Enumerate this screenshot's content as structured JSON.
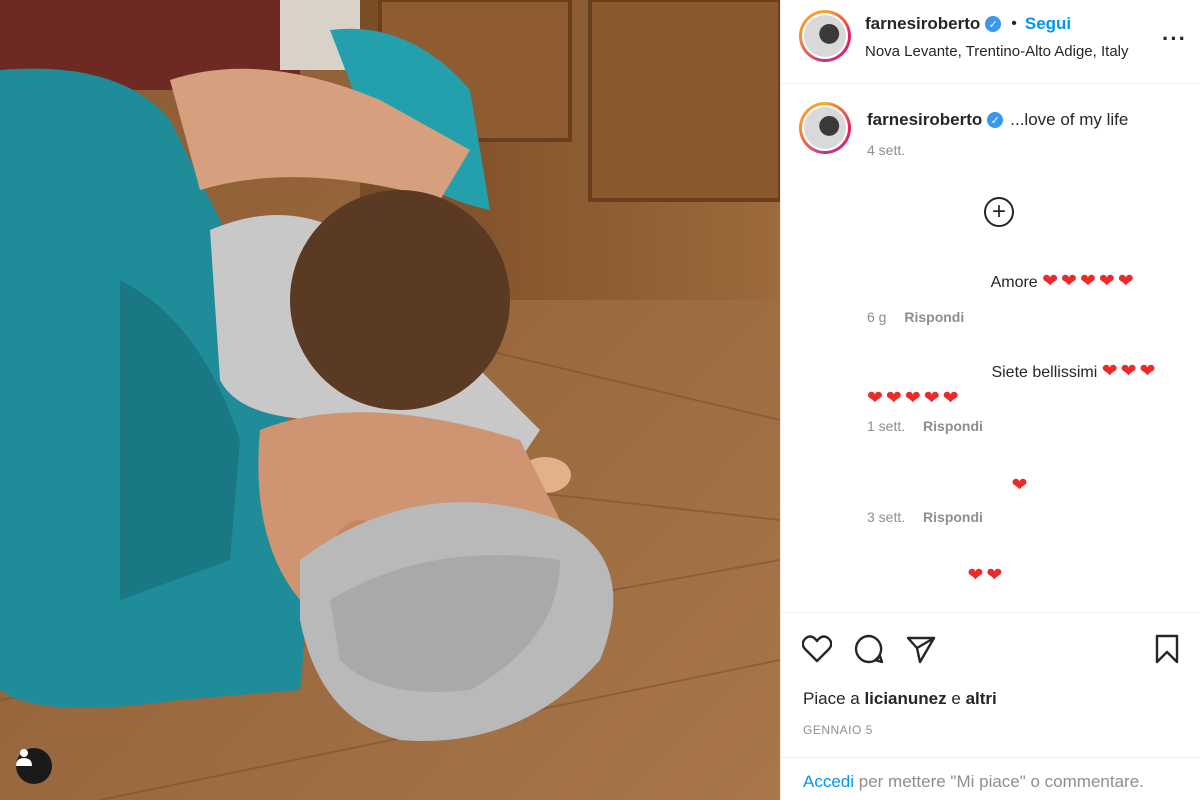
{
  "header": {
    "username": "farnesiroberto",
    "separator": "•",
    "follow_label": "Segui",
    "location": "Nova Levante, Trentino-Alto Adige, Italy",
    "more_glyph": "···"
  },
  "caption": {
    "username": "farnesiroberto",
    "text": "...love of my life",
    "time": "4 sett."
  },
  "load_more_glyph": "+",
  "comments": [
    {
      "text": "Amore",
      "hearts": "❤❤❤❤❤",
      "time": "6 g",
      "reply": "Rispondi"
    },
    {
      "text": "Siete bellissimi",
      "hearts": "❤❤❤",
      "hearts_line2": "❤❤❤❤❤",
      "time": "1 sett.",
      "reply": "Rispondi"
    },
    {
      "hearts": "❤",
      "time": "3 sett.",
      "reply": "Rispondi"
    },
    {
      "hearts": "❤❤"
    }
  ],
  "actions": {
    "likes_prefix": "Piace a",
    "likes_user": "licianunez",
    "likes_join": "e",
    "likes_rest": "altri",
    "date": "GENNAIO 5"
  },
  "login": {
    "link": "Accedi",
    "rest": "per mettere \"Mi piace\" o commentare."
  },
  "colors": {
    "link_blue": "#0095f6",
    "verified_blue": "#3897f0",
    "heart_red": "#ed2a2a",
    "muted": "#8e8e8e"
  },
  "icons": [
    "heart-icon",
    "comment-icon",
    "share-icon",
    "bookmark-icon",
    "person-tag-icon",
    "verified-icon",
    "add-circle-icon"
  ]
}
